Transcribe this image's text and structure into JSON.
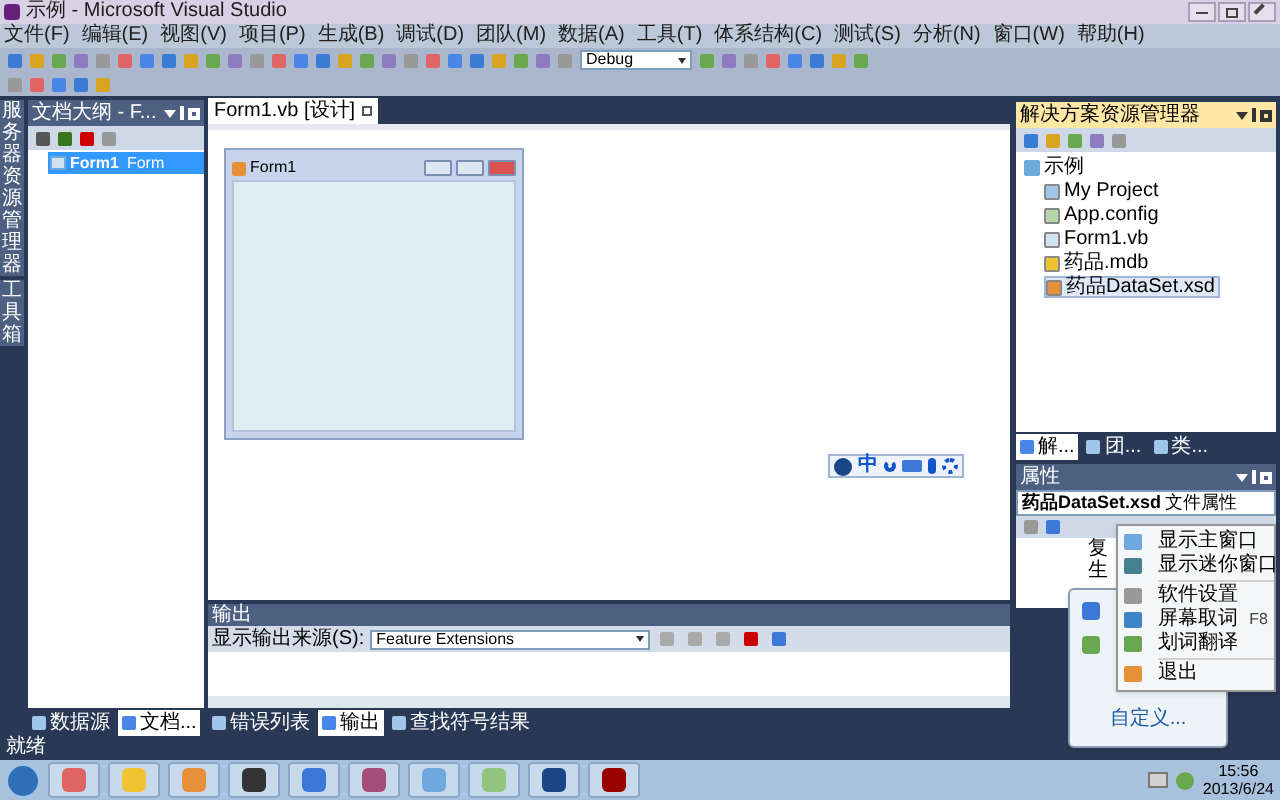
{
  "window": {
    "title": "示例 - Microsoft Visual Studio"
  },
  "menu": [
    "文件(F)",
    "编辑(E)",
    "视图(V)",
    "项目(P)",
    "生成(B)",
    "调试(D)",
    "团队(M)",
    "数据(A)",
    "工具(T)",
    "体系结构(C)",
    "测试(S)",
    "分析(N)",
    "窗口(W)",
    "帮助(H)"
  ],
  "toolbar": {
    "config": "Debug"
  },
  "side_strip": [
    "服务器资源管理器",
    "工具箱"
  ],
  "document_outline": {
    "title": "文档大纲 - F...",
    "items": [
      {
        "name": "Form1",
        "type": "Form",
        "selected": true
      }
    ]
  },
  "left_tabs": [
    {
      "label": "数据源",
      "selected": false
    },
    {
      "label": "文档...",
      "selected": true
    }
  ],
  "doc_tabs": [
    {
      "label": "Form1.vb [设计]",
      "selected": true
    }
  ],
  "form": {
    "title": "Form1"
  },
  "ime_bar": {
    "label": "中"
  },
  "output": {
    "title": "输出",
    "source_label": "显示输出来源(S):",
    "source": "Feature Extensions"
  },
  "bottom_tabs": [
    {
      "label": "错误列表",
      "selected": false
    },
    {
      "label": "输出",
      "selected": true
    },
    {
      "label": "查找符号结果",
      "selected": false
    }
  ],
  "solution_explorer": {
    "title": "解决方案资源管理器",
    "root": "示例",
    "items": [
      {
        "label": "My Project",
        "kind": "project",
        "selected": false
      },
      {
        "label": "App.config",
        "kind": "config",
        "selected": false
      },
      {
        "label": "Form1.vb",
        "kind": "form",
        "selected": false
      },
      {
        "label": "药品.mdb",
        "kind": "database",
        "selected": false
      },
      {
        "label": "药品DataSet.xsd",
        "kind": "dataset",
        "selected": true
      }
    ]
  },
  "right_tabs": [
    {
      "label": "解...",
      "selected": true
    },
    {
      "label": "团...",
      "selected": false
    },
    {
      "label": "类...",
      "selected": false
    }
  ],
  "properties": {
    "title": "属性",
    "object": "药品DataSet.xsd",
    "object_type": "文件属性",
    "rows": [
      "复",
      "生"
    ]
  },
  "status_bar": {
    "text": "就绪"
  },
  "tray_popup": {
    "link": "自定义..."
  },
  "context_menu": [
    {
      "kind": "item",
      "label": "显示主窗口"
    },
    {
      "kind": "item",
      "label": "显示迷你窗口"
    },
    {
      "kind": "separator"
    },
    {
      "kind": "item",
      "label": "软件设置"
    },
    {
      "kind": "item",
      "label": "屏幕取词",
      "shortcut": "F8"
    },
    {
      "kind": "item",
      "label": "划词翻译"
    },
    {
      "kind": "separator"
    },
    {
      "kind": "item",
      "label": "退出"
    }
  ],
  "taskbar": {
    "time": "15:56",
    "date": "2013/6/24"
  }
}
